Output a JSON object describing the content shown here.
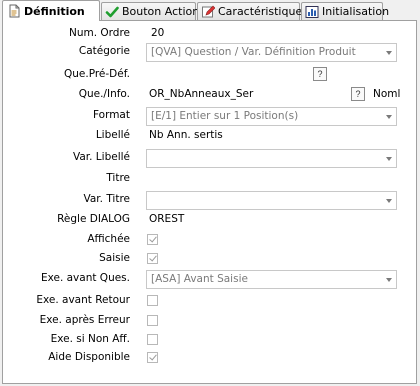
{
  "tabs": [
    {
      "label": "Définition",
      "icon": "document-icon",
      "active": true
    },
    {
      "label": "Bouton Action",
      "icon": "check-icon",
      "active": false
    },
    {
      "label": "Caractéristiques",
      "icon": "pencil-icon",
      "active": false
    },
    {
      "label": "Initialisation",
      "icon": "chart-icon",
      "active": false
    }
  ],
  "form": {
    "num_ordre_label": "Num. Ordre",
    "num_ordre_value": "20",
    "categorie_label": "Catégorie",
    "categorie_value": "[QVA] Question / Var. Définition Produit",
    "que_pre_def_label": "Que.Pré-Déf.",
    "que_pre_def_btn": "?",
    "que_info_label": "Que./Info.",
    "que_info_value": "OR_NbAnneaux_Ser",
    "que_info_btn": "?",
    "noml_label": "Noml",
    "format_label": "Format",
    "format_value": "[E/1] Entier sur 1 Position(s)",
    "libelle_label": "Libellé",
    "libelle_value": "Nb Ann. sertis",
    "var_libelle_label": "Var. Libellé",
    "var_libelle_value": "",
    "titre_label": "Titre",
    "titre_value": "",
    "var_titre_label": "Var. Titre",
    "var_titre_value": "",
    "regle_label": "Règle DIALOG",
    "regle_value": "OREST",
    "affichee_label": "Affichée",
    "saisie_label": "Saisie",
    "exe_avant_ques_label": "Exe. avant Ques.",
    "exe_avant_ques_value": "[ASA] Avant Saisie",
    "exe_avant_retour_label": "Exe. avant Retour",
    "exe_apres_erreur_label": "Exe. après Erreur",
    "exe_si_non_aff_label": "Exe. si Non Aff.",
    "aide_disponible_label": "Aide Disponible"
  },
  "checkboxes": {
    "affichee": true,
    "saisie": true,
    "exe_avant_retour": false,
    "exe_apres_erreur": false,
    "exe_si_non_aff": false,
    "aide_disponible": true
  }
}
